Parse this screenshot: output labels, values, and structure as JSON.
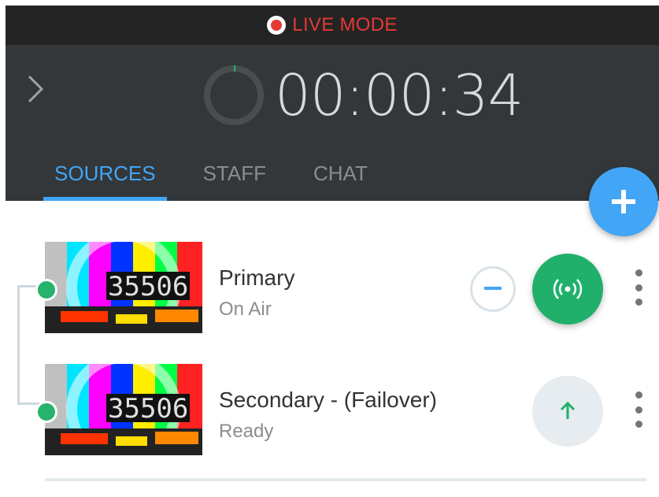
{
  "status_bar": {
    "label": "LIVE MODE",
    "color": "#e53935"
  },
  "header": {
    "timer": "00:00:34",
    "progress": 0.01,
    "tabs": [
      {
        "label": "SOURCES",
        "active": true
      },
      {
        "label": "STAFF",
        "active": false
      },
      {
        "label": "CHAT",
        "active": false
      }
    ]
  },
  "fab": {
    "icon": "plus-icon"
  },
  "sources": [
    {
      "name": "Primary",
      "status": "On Air",
      "thumbnail_text": "35506",
      "action_icon": "broadcast-icon"
    },
    {
      "name": "Secondary - (Failover)",
      "status": "Ready",
      "thumbnail_text": "35506",
      "action_icon": "arrow-up-icon"
    }
  ],
  "colors": {
    "accent": "#42a5f5",
    "on_air": "#21b06b",
    "header_bg": "#34373a",
    "topbar_bg": "#242424"
  }
}
